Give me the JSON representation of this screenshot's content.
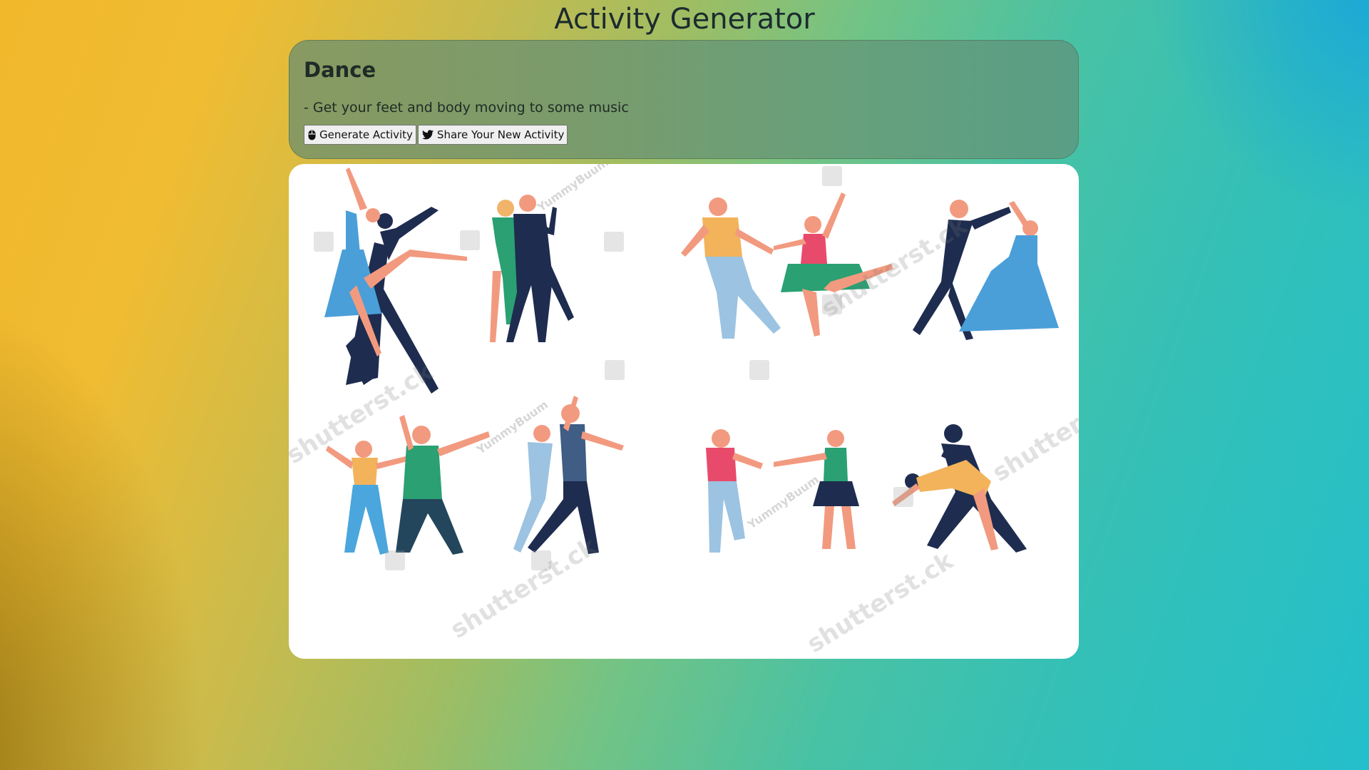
{
  "page": {
    "title": "Activity Generator"
  },
  "activity": {
    "name": "Dance",
    "description": "- Get your feet and body moving to some music"
  },
  "buttons": {
    "generate": {
      "label": "Generate Activity",
      "icon": "mouse-icon"
    },
    "share": {
      "label": "Share Your New Activity",
      "icon": "twitter-icon"
    }
  },
  "image": {
    "content": "Illustration of eight couples dancing in different styles",
    "watermarks": [
      "shutterst.ck",
      "YummyBuum"
    ]
  },
  "colors": {
    "card_background": "#7b9b6b",
    "panel_background": "#ffffff",
    "button_background": "#efefef",
    "gradient_left": "#f1b82c",
    "gradient_right": "#24bfcb"
  }
}
